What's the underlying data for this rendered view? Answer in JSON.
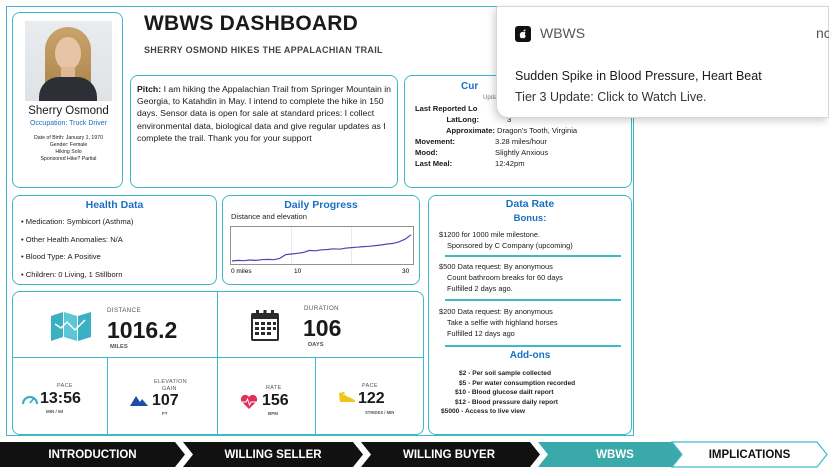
{
  "dashboard": {
    "title": "WBWS DASHBOARD",
    "subtitle": "SHERRY OSMOND HIKES THE APPALACHIAN TRAIL"
  },
  "profile": {
    "name": "Sherry Osmond",
    "occupation": "Occupation: Truck Driver",
    "details": [
      "Date of Birth: January 1, 1970",
      "Gender: Female",
      "Hiking Solo",
      "Sponsored Hike? Partial"
    ]
  },
  "pitch": {
    "label": "Pitch:",
    "text": "I am hiking the Appalachian Trail from Springer Mountain in Georgia, to Katahdin in May. I intend to complete the hike in 150 days. Sensor data is open for sale at standard prices: I collect environmental data, biological data and give regular updates as I complete the trail. Thank you for your support"
  },
  "current": {
    "title_visible": "Cur",
    "updated_visible": "Upda",
    "last_reported_visible": "Last Reported Lo",
    "latlong_label": "LatLong:",
    "latlong_value": "3",
    "approx_label": "Approximate:",
    "approx_value": "Dragon's Tooth, Virginia",
    "movement_label": "Movement:",
    "movement_value": "3.28 miles/hour",
    "mood_label": "Mood:",
    "mood_value": "Slightly Anxious",
    "meal_label": "Last Meal:",
    "meal_value": "12:42pm"
  },
  "health": {
    "title": "Health Data",
    "items": [
      "Medication: Symbicort (Asthma)",
      "Other Health Anomalies: N/A",
      "Blood Type: A Positive",
      "Children: 0 Living, 1 Stillborn"
    ]
  },
  "progress": {
    "title": "Daily Progress",
    "subtitle": "Distance and elevation",
    "x_label_start": "0 miles",
    "x_label_mid": "10",
    "x_label_end": "30",
    "line_color": "#5b3fb5"
  },
  "chart_data": {
    "type": "line",
    "title": "",
    "xlabel": "",
    "ylabel": "",
    "xlim": [
      0,
      30
    ],
    "series": [
      {
        "x": [
          0,
          1,
          2,
          3,
          4,
          5,
          6,
          7,
          8,
          9,
          10,
          11,
          12,
          13,
          14,
          15,
          16,
          17,
          18,
          19,
          20,
          21,
          22,
          23,
          24,
          25,
          26,
          27,
          28,
          29,
          30
        ],
        "values": [
          0.0,
          0.02,
          0.01,
          0.03,
          0.02,
          0.04,
          0.05,
          0.04,
          0.08,
          0.2,
          0.22,
          0.24,
          0.27,
          0.33,
          0.32,
          0.35,
          0.36,
          0.38,
          0.37,
          0.4,
          0.42,
          0.43,
          0.45,
          0.46,
          0.48,
          0.5,
          0.53,
          0.55,
          0.6,
          0.68,
          0.82
        ]
      }
    ]
  },
  "datarate": {
    "title": "Data Rate",
    "bonus_title": "Bonus:",
    "bonus_line1": "$1200 for 1000 mile milestone.",
    "bonus_line2": "Sponsored by C Company (upcoming)",
    "req1_line1": "$500 Data request:  By anonymous",
    "req1_line2": "Count bathroom breaks for 60 days",
    "req1_line3": "Fulfilled 2 days ago.",
    "req2_line1": "$200 Data request:  By anonymous",
    "req2_line2": "Take a selfie with highland horses",
    "req2_line3": "Fulfilled 12 days ago",
    "addons_title": "Add-ons",
    "addons": [
      "$2 - Per soil sample collected",
      "$5 - Per water consumption recorded",
      "$10 - Blood glucose dailt report",
      "$12 - Blood pressure daily report",
      "$5000 - Access to live view"
    ]
  },
  "stats": {
    "distance": {
      "label": "DISTANCE",
      "value": "1016.2",
      "unit": "MILES",
      "icon": "map-icon"
    },
    "duration": {
      "label": "DURATION",
      "value": "106",
      "unit": "DAYS",
      "icon": "calendar-icon"
    },
    "pace1": {
      "label": "PACE",
      "value": "13:56",
      "unit": "MIN / MI",
      "icon": "speedometer-icon"
    },
    "elevation": {
      "label": "ELEVATION",
      "label2": "GAIN",
      "value": "107",
      "unit": "FT",
      "icon": "mountain-icon"
    },
    "rate": {
      "label": "RATE",
      "value": "156",
      "unit": "BPM",
      "icon": "heartbeat-icon"
    },
    "pace2": {
      "label": "PACE",
      "value": "122",
      "unit": "STRIDES / MIN",
      "icon": "shoe-icon"
    }
  },
  "notification": {
    "app": "WBWS",
    "more": "nc",
    "title": "Sudden Spike in Blood Pressure, Heart Beat",
    "body": "Tier 3 Update: Click to Watch Live."
  },
  "nav": {
    "items": [
      "INTRODUCTION",
      "WILLING SELLER",
      "WILLING BUYER",
      "WBWS",
      "IMPLICATIONS"
    ],
    "active_index": 3,
    "colors": {
      "dark": "#111111",
      "active": "#3aa9aa",
      "light": "#ffffff",
      "accent": "#3fb8c9"
    }
  }
}
